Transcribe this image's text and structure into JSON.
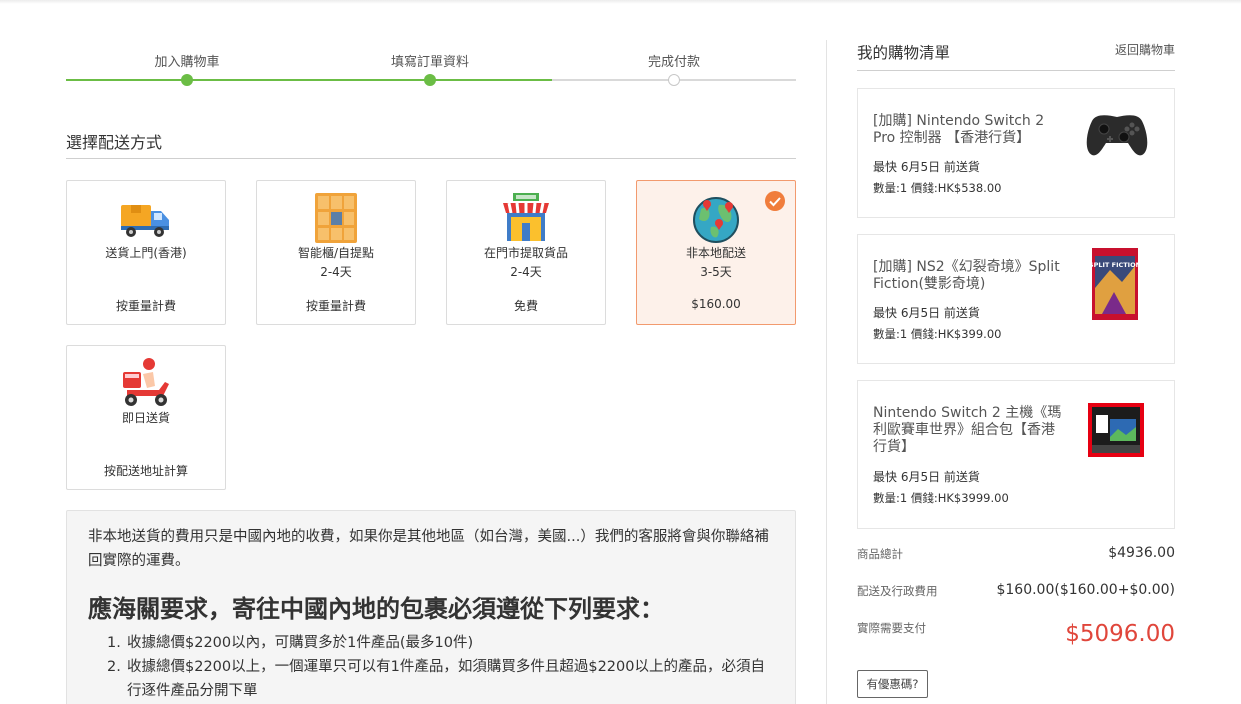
{
  "steps": [
    {
      "label": "加入購物車",
      "done": true
    },
    {
      "label": "填寫訂單資料",
      "done": true
    },
    {
      "label": "完成付款",
      "done": false
    }
  ],
  "shipping": {
    "title": "選擇配送方式",
    "options": [
      {
        "name": "送貨上門(香港)",
        "days": "",
        "price": "按重量計費",
        "icon": "delivery-truck-icon",
        "selected": false
      },
      {
        "name": "智能櫃/自提點",
        "days": "2-4天",
        "price": "按重量計費",
        "icon": "locker-icon",
        "selected": false
      },
      {
        "name": "在門市提取貨品",
        "days": "2-4天",
        "price": "免費",
        "icon": "store-icon",
        "selected": false
      },
      {
        "name": "非本地配送",
        "days": "3-5天",
        "price": "$160.00",
        "icon": "globe-icon",
        "selected": true
      },
      {
        "name": "即日送貨",
        "days": "",
        "price": "按配送地址計算",
        "icon": "scooter-icon",
        "selected": false
      }
    ]
  },
  "notice": {
    "text": "非本地送貨的費用只是中國內地的收費，如果你是其他地區（如台灣，美國...）我們的客服將會與你聯絡補回實際的運費。",
    "heading": "應海關要求，寄往中國內地的包裹必須遵從下列要求：",
    "items": [
      {
        "num": "1.",
        "text": "收據總價$2200以內，可購買多於1件產品(最多10件)"
      },
      {
        "num": "2.",
        "text": "收據總價$2200以上，一個運單只可以有1件產品，如須購買多件且超過$2200以上的產品，必須自行逐件產品分開下單"
      }
    ]
  },
  "cart": {
    "title": "我的購物清單",
    "back_label": "返回購物車",
    "items": [
      {
        "title": "[加購] Nintendo Switch 2 Pro 控制器 【香港行貨】",
        "ship": "最快 6月5日 前送貨",
        "qty": "數量:1    價錢:HK$538.00",
        "thumb": "controller"
      },
      {
        "title": "[加購] NS2《幻裂奇境》Split Fiction(雙影奇境)",
        "ship": "最快 6月5日 前送貨",
        "qty": "數量:1    價錢:HK$399.00",
        "thumb": "game",
        "thumb_text": "SPLIT FICTION"
      },
      {
        "title": "Nintendo Switch 2 主機《瑪利歐賽車世界》組合包【香港行貨】",
        "ship": "最快 6月5日 前送貨",
        "qty": "數量:1    價錢:HK$3999.00",
        "thumb": "console"
      }
    ],
    "summary": {
      "subtotal_label": "商品總計",
      "subtotal": "$4936.00",
      "shipping_label": "配送及行政費用",
      "shipping": "$160.00($160.00+$0.00)",
      "total_label": "實際需要支付",
      "total": "$5096.00"
    },
    "coupon_label": "有優惠碼?"
  },
  "colors": {
    "accent_green": "#6bbd45",
    "selected_orange": "#f07d3c",
    "total_red": "#e0463b"
  }
}
